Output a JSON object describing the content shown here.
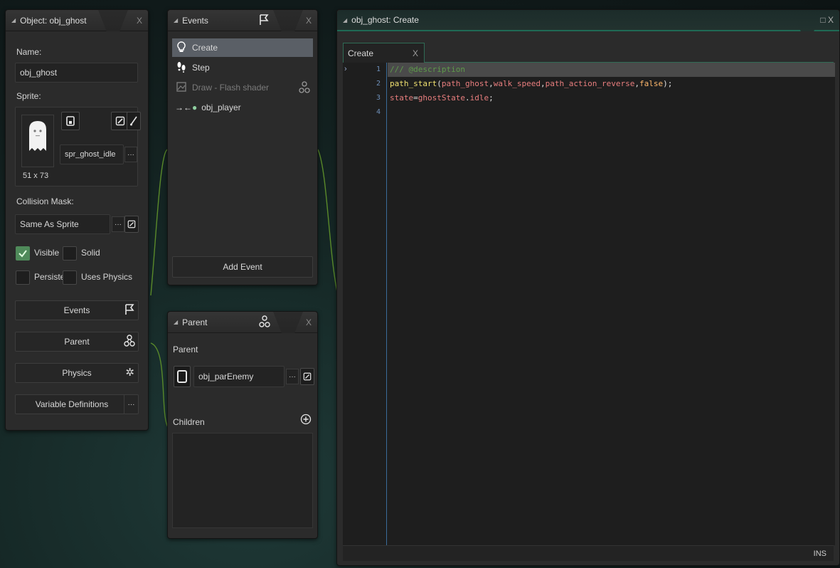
{
  "object_panel": {
    "title": "Object: obj_ghost",
    "name_label": "Name:",
    "name_value": "obj_ghost",
    "sprite_label": "Sprite:",
    "sprite_name": "spr_ghost_idle",
    "sprite_size": "51 x 73",
    "collision_label": "Collision Mask:",
    "collision_value": "Same As Sprite",
    "visible_label": "Visible",
    "solid_label": "Solid",
    "persistent_label": "Persistent",
    "physics_check_label": "Uses Physics",
    "events_button": "Events",
    "parent_button": "Parent",
    "physics_button": "Physics",
    "variables_button": "Variable Definitions",
    "visible_checked": true,
    "solid_checked": false,
    "persistent_checked": false,
    "uses_physics_checked": false,
    "more_glyph": "···",
    "close_glyph": "X"
  },
  "events_panel": {
    "title": "Events",
    "items": [
      {
        "label": "Create",
        "icon": "lightbulb-icon",
        "selected": true
      },
      {
        "label": "Step",
        "icon": "footsteps-icon",
        "selected": false
      },
      {
        "label": "Draw - Flash shader",
        "icon": "image-icon",
        "selected": false,
        "dimmed": true
      },
      {
        "label": "obj_player",
        "icon": "collision-icon",
        "selected": false
      }
    ],
    "add_event_label": "Add Event",
    "close_glyph": "X"
  },
  "parent_panel": {
    "title": "Parent",
    "parent_label": "Parent",
    "parent_value": "obj_parEnemy",
    "children_label": "Children",
    "close_glyph": "X"
  },
  "code_panel": {
    "title": "obj_ghost: Create",
    "tab_label": "Create",
    "tab_close": "X",
    "status": "INS",
    "window_controls": "□ X",
    "line_numbers": [
      "1",
      "2",
      "3",
      "4"
    ],
    "lines": [
      [
        {
          "t": "/// @description",
          "c": "cm"
        }
      ],
      [
        {
          "t": "path_start",
          "c": "fn"
        },
        {
          "t": "(",
          "c": "pl"
        },
        {
          "t": "path_ghost",
          "c": "id"
        },
        {
          "t": ",",
          "c": "pl"
        },
        {
          "t": "walk_speed",
          "c": "id"
        },
        {
          "t": ",",
          "c": "pl"
        },
        {
          "t": "path_action_reverse",
          "c": "id"
        },
        {
          "t": ",",
          "c": "pl"
        },
        {
          "t": "false",
          "c": "kw"
        },
        {
          "t": ");",
          "c": "pl"
        }
      ],
      [
        {
          "t": "state",
          "c": "id"
        },
        {
          "t": "=",
          "c": "pl"
        },
        {
          "t": "ghostState",
          "c": "id"
        },
        {
          "t": ".",
          "c": "pl"
        },
        {
          "t": "idle",
          "c": "id"
        },
        {
          "t": ";",
          "c": "pl"
        }
      ],
      []
    ]
  },
  "colors": {
    "accent_green": "#1f6a55",
    "check_green": "#4f8a5a",
    "selection": "#5a5f66"
  }
}
